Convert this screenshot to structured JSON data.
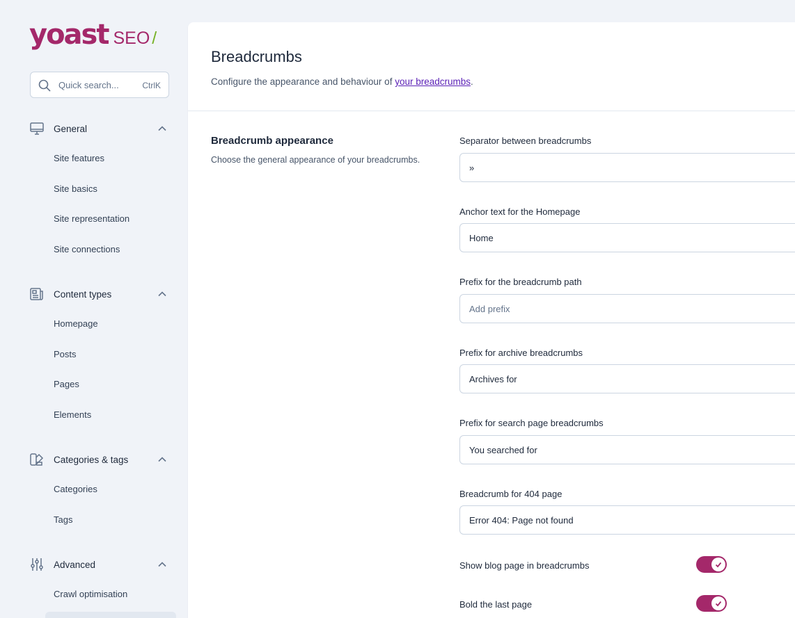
{
  "brand": {
    "word": "yoast",
    "product": "SEO",
    "slash": "/",
    "color": "#a4286a",
    "slash_color": "#77b227"
  },
  "search": {
    "placeholder": "Quick search...",
    "shortcut": "CtrlK"
  },
  "sidebar": {
    "groups": [
      {
        "label": "General",
        "icon": "monitor-icon",
        "items": [
          "Site features",
          "Site basics",
          "Site representation",
          "Site connections"
        ]
      },
      {
        "label": "Content types",
        "icon": "newspaper-icon",
        "items": [
          "Homepage",
          "Posts",
          "Pages",
          "Elements"
        ]
      },
      {
        "label": "Categories & tags",
        "icon": "color-swatch-icon",
        "items": [
          "Categories",
          "Tags"
        ]
      },
      {
        "label": "Advanced",
        "icon": "adjustments-icon",
        "items": [
          "Crawl optimisation"
        ]
      }
    ]
  },
  "main": {
    "title": "Breadcrumbs",
    "desc_prefix": "Configure the appearance and behaviour of ",
    "desc_link": "your breadcrumbs",
    "desc_suffix": ".",
    "section": {
      "title": "Breadcrumb appearance",
      "desc": "Choose the general appearance of your breadcrumbs."
    },
    "fields": [
      {
        "label": "Separator between breadcrumbs",
        "value": "»",
        "placeholder": ""
      },
      {
        "label": "Anchor text for the Homepage",
        "value": "Home",
        "placeholder": ""
      },
      {
        "label": "Prefix for the breadcrumb path",
        "value": "",
        "placeholder": "Add prefix"
      },
      {
        "label": "Prefix for archive breadcrumbs",
        "value": "Archives for",
        "placeholder": ""
      },
      {
        "label": "Prefix for search page breadcrumbs",
        "value": "You searched for",
        "placeholder": ""
      },
      {
        "label": "Breadcrumb for 404 page",
        "value": "Error 404: Page not found",
        "placeholder": ""
      }
    ],
    "toggles": [
      {
        "label": "Show blog page in breadcrumbs",
        "on": true
      },
      {
        "label": "Bold the last page",
        "on": true
      }
    ]
  }
}
